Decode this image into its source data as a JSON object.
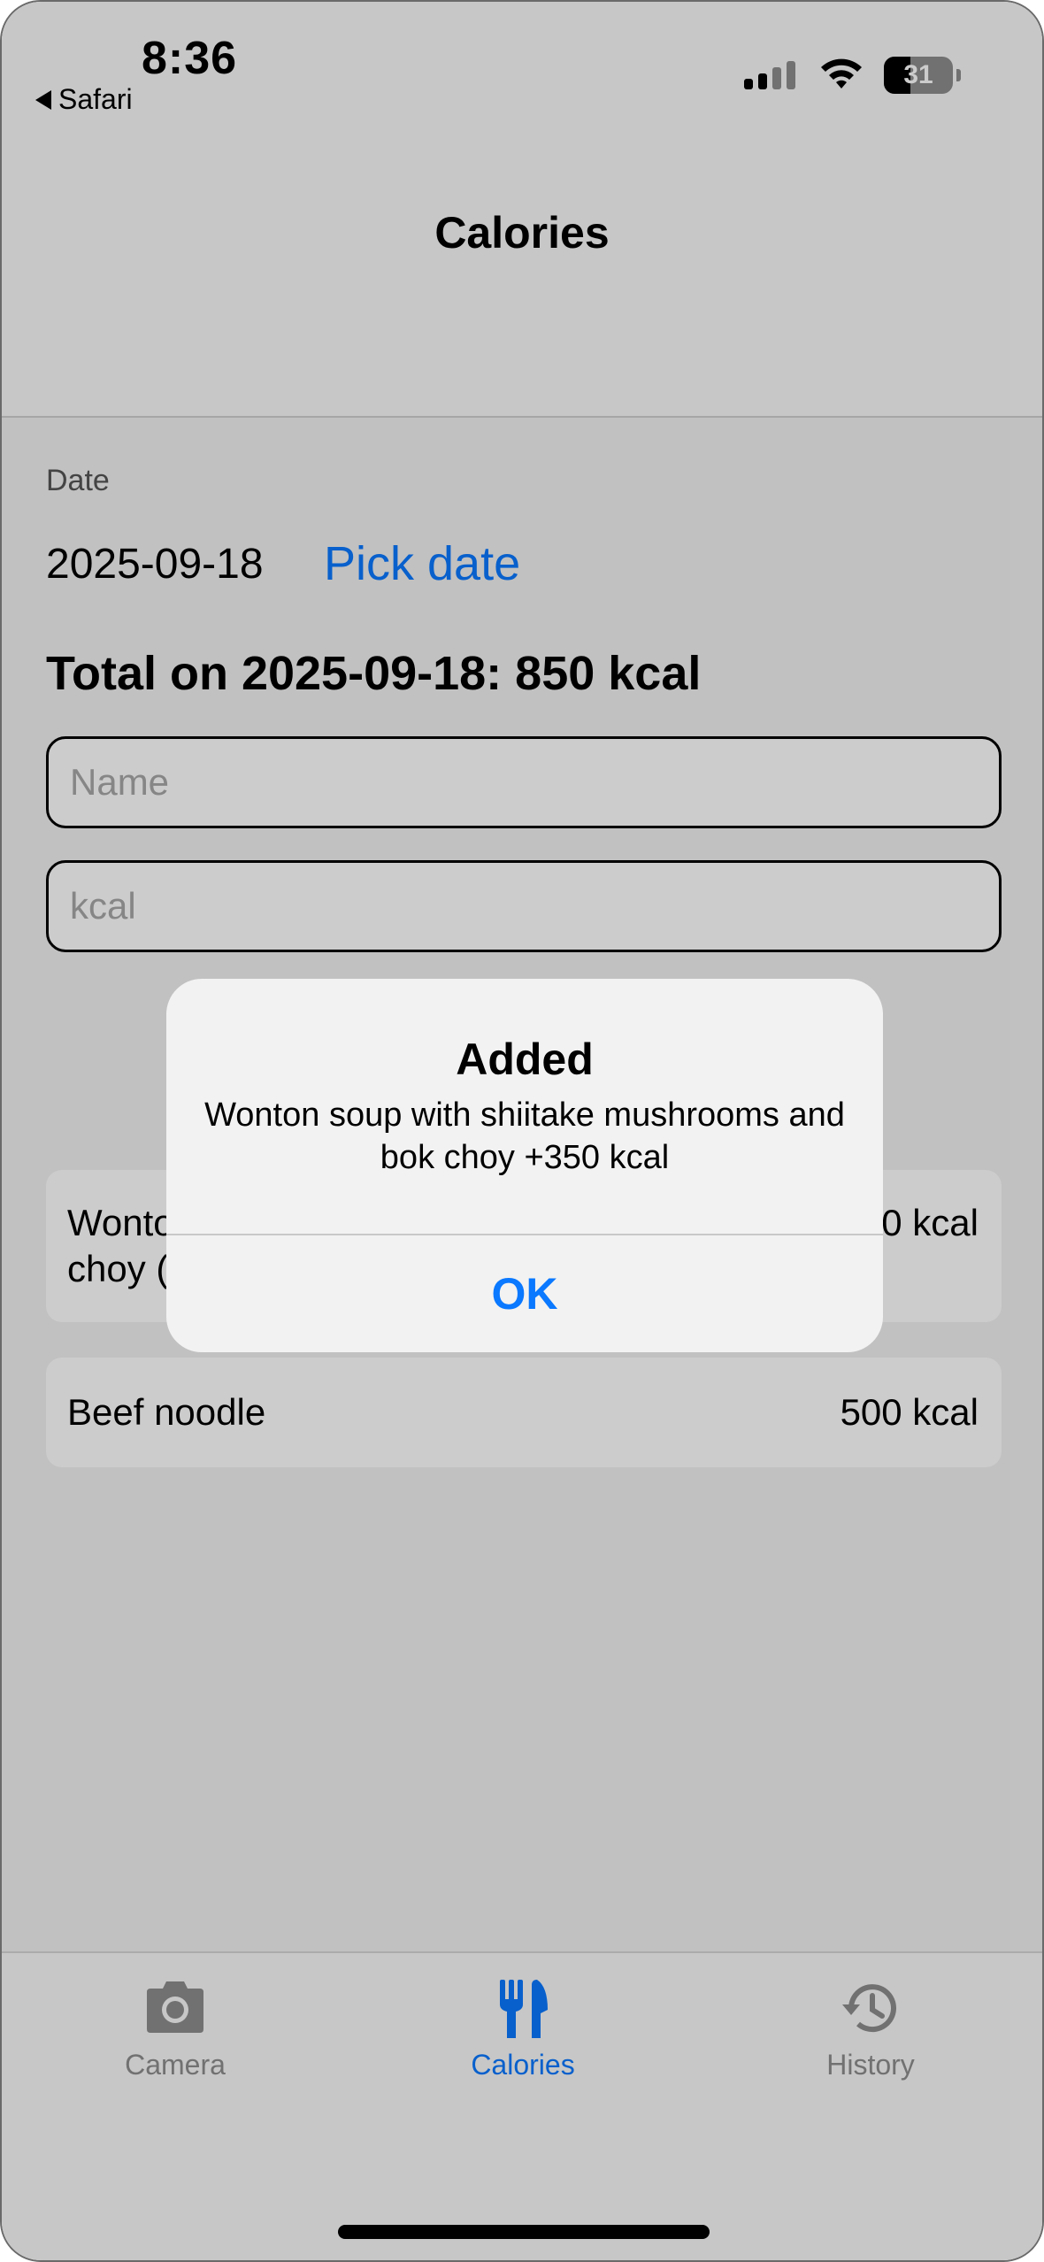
{
  "status_bar": {
    "time": "8:36",
    "back_app": "Safari",
    "battery": "31"
  },
  "nav": {
    "title": "Calories"
  },
  "form": {
    "date_label": "Date",
    "date_value": "2025-09-18",
    "pick_date": "Pick date",
    "total": "Total on 2025-09-18: 850 kcal",
    "name_placeholder": "Name",
    "kcal_placeholder": "kcal"
  },
  "entries": [
    {
      "name": "Wonton soup with shiitake mushrooms and bok choy (400g)",
      "kcal": "350 kcal"
    },
    {
      "name": "Beef noodle",
      "kcal": "500 kcal"
    }
  ],
  "alert": {
    "title": "Added",
    "message": "Wonton soup with shiitake mushrooms and bok choy +350 kcal",
    "ok": "OK"
  },
  "tabs": [
    {
      "label": "Camera",
      "icon": "camera-icon",
      "active": false
    },
    {
      "label": "Calories",
      "icon": "fork-knife-icon",
      "active": true
    },
    {
      "label": "History",
      "icon": "history-icon",
      "active": false
    }
  ],
  "colors": {
    "accent": "#0a78ff",
    "inactive": "#8e8e8e"
  }
}
